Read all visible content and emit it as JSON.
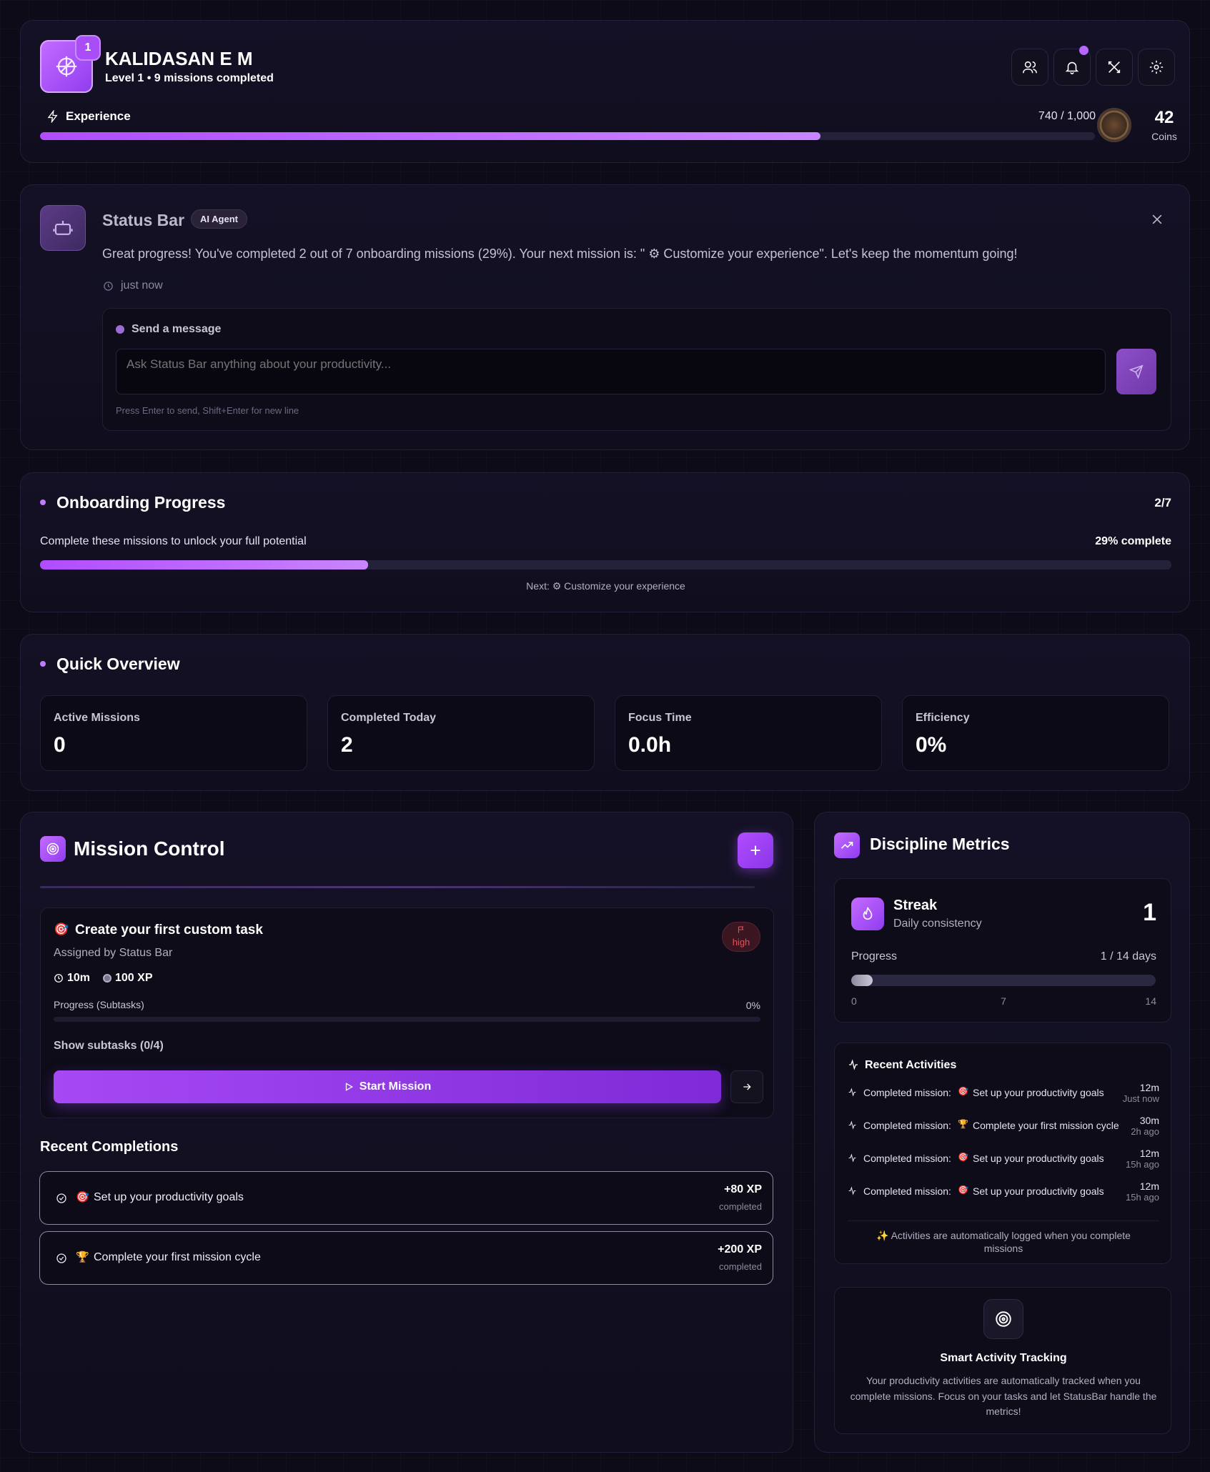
{
  "profile": {
    "name": "KALIDASAN E M",
    "level_badge": "1",
    "subtitle": "Level 1 • 9 missions completed",
    "xp_label": "Experience",
    "xp_text": "740 / 1,000",
    "xp_progress": 0.74,
    "coins_value": "42",
    "coins_label": "Coins"
  },
  "header_icons": [
    "users-icon",
    "bell-icon",
    "tools-icon",
    "gear-icon"
  ],
  "agent": {
    "name": "Status Bar",
    "badge": "AI Agent",
    "message": "Great progress! You've completed 2 out of 7 onboarding missions (29%). Your next mission is: \" ⚙ Customize your experience\". Let's keep the momentum going!",
    "time": "just now",
    "send_label": "Send a message",
    "input_placeholder": "Ask Status Bar anything about your productivity...",
    "hint": "Press Enter to send, Shift+Enter for new line"
  },
  "onboarding": {
    "title": "Onboarding Progress",
    "count": "2/7",
    "description": "Complete these missions to unlock your full potential",
    "percent_text": "29% complete",
    "progress": 0.29,
    "next_text": "Next: ⚙ Customize your experience"
  },
  "overview": {
    "title": "Quick Overview",
    "stats": [
      {
        "label": "Active Missions",
        "value": "0"
      },
      {
        "label": "Completed Today",
        "value": "2"
      },
      {
        "label": "Focus Time",
        "value": "0.0h"
      },
      {
        "label": "Efficiency",
        "value": "0%"
      }
    ]
  },
  "mission_control": {
    "title": "Mission Control",
    "task": {
      "emoji": "🎯",
      "title": "Create your first custom task",
      "assigned": "Assigned by Status Bar",
      "priority": "high",
      "duration": "10m",
      "xp": "100 XP",
      "progress_label": "Progress (Subtasks)",
      "progress_value": "0%",
      "progress": 0,
      "subtasks_label": "Show subtasks (0/4)",
      "start_label": "Start Mission"
    },
    "recent_title": "Recent Completions",
    "recent": [
      {
        "emoji": "🎯",
        "title": "Set up your productivity goals",
        "xp": "+80 XP",
        "status": "completed"
      },
      {
        "emoji": "🏆",
        "title": "Complete your first mission cycle",
        "xp": "+200 XP",
        "status": "completed"
      }
    ]
  },
  "discipline": {
    "title": "Discipline Metrics",
    "streak": {
      "title": "Streak",
      "subtitle": "Daily consistency",
      "value": "1",
      "progress_label": "Progress",
      "progress_text": "1 / 14 days",
      "progress": 0.0714,
      "ticks": [
        "0",
        "7",
        "14"
      ]
    },
    "activities_title": "Recent Activities",
    "activities": [
      {
        "prefix": "Completed mission:",
        "emoji": "🎯",
        "title": "Set up your productivity goals",
        "duration": "12m",
        "ago": "Just now"
      },
      {
        "prefix": "Completed mission:",
        "emoji": "🏆",
        "title": "Complete your first mission cycle",
        "duration": "30m",
        "ago": "2h ago"
      },
      {
        "prefix": "Completed mission:",
        "emoji": "🎯",
        "title": "Set up your productivity goals",
        "duration": "12m",
        "ago": "15h ago"
      },
      {
        "prefix": "Completed mission:",
        "emoji": "🎯",
        "title": "Set up your productivity goals",
        "duration": "12m",
        "ago": "15h ago"
      }
    ],
    "activities_note": "✨ Activities are automatically logged when you complete missions",
    "tracking_title": "Smart Activity Tracking",
    "tracking_text": "Your productivity activities are automatically tracked when you complete missions. Focus on your tasks and let StatusBar handle the metrics!"
  },
  "colors": {
    "accent": "#a855f7",
    "accent_light": "#c27bff",
    "background": "#0d0b17",
    "card": "#141126",
    "high_priority": "#e0525b"
  }
}
